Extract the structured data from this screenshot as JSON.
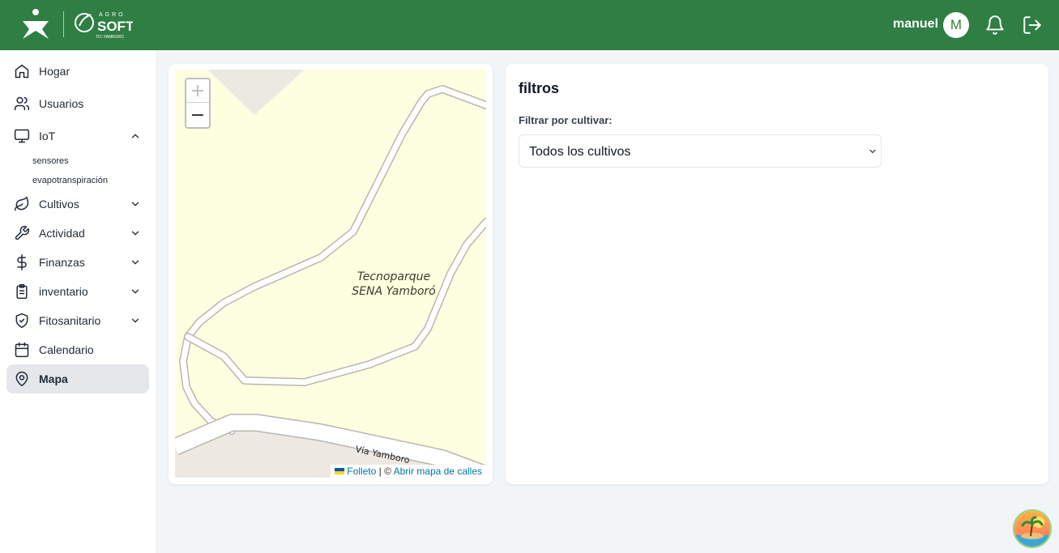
{
  "header": {
    "logo_sena_text": "SENA",
    "logo_agro_top": "AGRO",
    "logo_agro_main": "SOFT",
    "logo_agro_sub": "TIC-YAMBORÓ",
    "user_name": "manuel",
    "avatar_initial": "M",
    "bg_color": "#2f7e43"
  },
  "sidebar": {
    "items": [
      {
        "label": "Hogar",
        "icon": "home-icon"
      },
      {
        "label": "Usuarios",
        "icon": "users-icon"
      },
      {
        "label": "IoT",
        "icon": "monitor-icon",
        "expanded": true
      },
      {
        "label": "Cultivos",
        "icon": "leaf-icon"
      },
      {
        "label": "Actividad",
        "icon": "wrench-icon"
      },
      {
        "label": "Finanzas",
        "icon": "dollar-icon"
      },
      {
        "label": "inventario",
        "icon": "clipboard-icon"
      },
      {
        "label": "Fitosanitario",
        "icon": "shield-check-icon"
      },
      {
        "label": "Calendario",
        "icon": "calendar-icon"
      },
      {
        "label": "Mapa",
        "icon": "map-pin-icon",
        "active": true
      }
    ],
    "iot_subitems": [
      "sensores",
      "evapotranspiración"
    ]
  },
  "map": {
    "place_label_line1": "Tecnoparque",
    "place_label_line2": "SENA Yamboró",
    "road_label": "Vía Yamboro",
    "zoom_in": "+",
    "zoom_out": "−",
    "attribution_leaflet": "Folleto",
    "attribution_sep": " | © ",
    "attribution_osm": "Abrir mapa de calles"
  },
  "filters": {
    "title": "filtros",
    "label": "Filtrar por cultivar:",
    "selected": "Todos los cultivos"
  }
}
